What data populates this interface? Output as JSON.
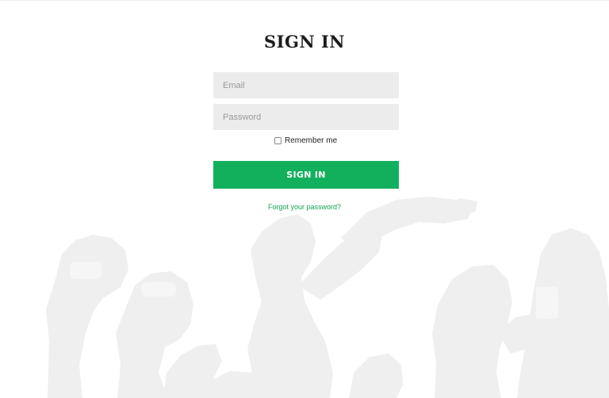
{
  "form": {
    "title": "SIGN IN",
    "email_placeholder": "Email",
    "password_placeholder": "Password",
    "remember_label": "Remember me",
    "submit_label": "SIGN IN",
    "forgot_label": "Forgot your password?"
  },
  "colors": {
    "accent": "#12b05c",
    "link": "#12a456",
    "field_bg": "#ececec",
    "background_art": "#efefef"
  }
}
